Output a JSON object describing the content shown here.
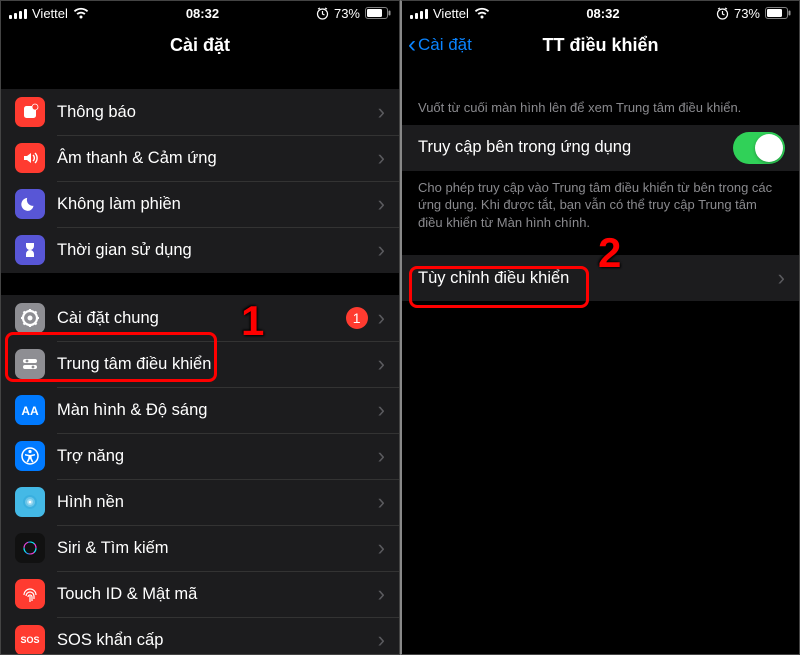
{
  "statusBar": {
    "carrier": "Viettel",
    "time": "08:32",
    "batteryPct": "73%"
  },
  "left": {
    "title": "Cài đặt",
    "group1": [
      {
        "id": "notifications",
        "label": "Thông báo"
      },
      {
        "id": "sounds",
        "label": "Âm thanh & Cảm ứng"
      },
      {
        "id": "dnd",
        "label": "Không làm phiền"
      },
      {
        "id": "screentime",
        "label": "Thời gian sử dụng"
      }
    ],
    "group2": [
      {
        "id": "general",
        "label": "Cài đặt chung",
        "badge": "1"
      },
      {
        "id": "controlcenter",
        "label": "Trung tâm điều khiển"
      },
      {
        "id": "display",
        "label": "Màn hình & Độ sáng"
      },
      {
        "id": "accessibility",
        "label": "Trợ năng"
      },
      {
        "id": "wallpaper",
        "label": "Hình nền"
      },
      {
        "id": "siri",
        "label": "Siri & Tìm kiếm"
      },
      {
        "id": "touchid",
        "label": "Touch ID & Mật mã"
      },
      {
        "id": "sos",
        "label": "SOS khẩn cấp"
      }
    ],
    "annotationNumber": "1"
  },
  "right": {
    "backLabel": "Cài đặt",
    "title": "TT điều khiển",
    "headerDesc": "Vuốt từ cuối màn hình lên để xem Trung tâm điều khiển.",
    "toggleLabel": "Truy cập bên trong ứng dụng",
    "toggleDesc": "Cho phép truy cập vào Trung tâm điều khiển từ bên trong các ứng dụng. Khi được tắt, bạn vẫn có thể truy cập Trung tâm điều khiển từ Màn hình chính.",
    "customizeLabel": "Tùy chỉnh điều khiển",
    "annotationNumber": "2"
  }
}
